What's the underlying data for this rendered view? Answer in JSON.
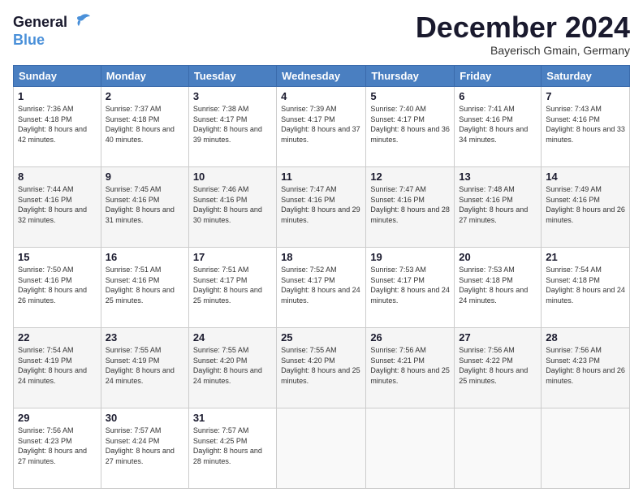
{
  "header": {
    "logo_line1": "General",
    "logo_line2": "Blue",
    "month": "December 2024",
    "location": "Bayerisch Gmain, Germany"
  },
  "days_of_week": [
    "Sunday",
    "Monday",
    "Tuesday",
    "Wednesday",
    "Thursday",
    "Friday",
    "Saturday"
  ],
  "weeks": [
    [
      {
        "day": "1",
        "sunrise": "7:36 AM",
        "sunset": "4:18 PM",
        "daylight": "8 hours and 42 minutes."
      },
      {
        "day": "2",
        "sunrise": "7:37 AM",
        "sunset": "4:18 PM",
        "daylight": "8 hours and 40 minutes."
      },
      {
        "day": "3",
        "sunrise": "7:38 AM",
        "sunset": "4:17 PM",
        "daylight": "8 hours and 39 minutes."
      },
      {
        "day": "4",
        "sunrise": "7:39 AM",
        "sunset": "4:17 PM",
        "daylight": "8 hours and 37 minutes."
      },
      {
        "day": "5",
        "sunrise": "7:40 AM",
        "sunset": "4:17 PM",
        "daylight": "8 hours and 36 minutes."
      },
      {
        "day": "6",
        "sunrise": "7:41 AM",
        "sunset": "4:16 PM",
        "daylight": "8 hours and 34 minutes."
      },
      {
        "day": "7",
        "sunrise": "7:43 AM",
        "sunset": "4:16 PM",
        "daylight": "8 hours and 33 minutes."
      }
    ],
    [
      {
        "day": "8",
        "sunrise": "7:44 AM",
        "sunset": "4:16 PM",
        "daylight": "8 hours and 32 minutes."
      },
      {
        "day": "9",
        "sunrise": "7:45 AM",
        "sunset": "4:16 PM",
        "daylight": "8 hours and 31 minutes."
      },
      {
        "day": "10",
        "sunrise": "7:46 AM",
        "sunset": "4:16 PM",
        "daylight": "8 hours and 30 minutes."
      },
      {
        "day": "11",
        "sunrise": "7:47 AM",
        "sunset": "4:16 PM",
        "daylight": "8 hours and 29 minutes."
      },
      {
        "day": "12",
        "sunrise": "7:47 AM",
        "sunset": "4:16 PM",
        "daylight": "8 hours and 28 minutes."
      },
      {
        "day": "13",
        "sunrise": "7:48 AM",
        "sunset": "4:16 PM",
        "daylight": "8 hours and 27 minutes."
      },
      {
        "day": "14",
        "sunrise": "7:49 AM",
        "sunset": "4:16 PM",
        "daylight": "8 hours and 26 minutes."
      }
    ],
    [
      {
        "day": "15",
        "sunrise": "7:50 AM",
        "sunset": "4:16 PM",
        "daylight": "8 hours and 26 minutes."
      },
      {
        "day": "16",
        "sunrise": "7:51 AM",
        "sunset": "4:16 PM",
        "daylight": "8 hours and 25 minutes."
      },
      {
        "day": "17",
        "sunrise": "7:51 AM",
        "sunset": "4:17 PM",
        "daylight": "8 hours and 25 minutes."
      },
      {
        "day": "18",
        "sunrise": "7:52 AM",
        "sunset": "4:17 PM",
        "daylight": "8 hours and 24 minutes."
      },
      {
        "day": "19",
        "sunrise": "7:53 AM",
        "sunset": "4:17 PM",
        "daylight": "8 hours and 24 minutes."
      },
      {
        "day": "20",
        "sunrise": "7:53 AM",
        "sunset": "4:18 PM",
        "daylight": "8 hours and 24 minutes."
      },
      {
        "day": "21",
        "sunrise": "7:54 AM",
        "sunset": "4:18 PM",
        "daylight": "8 hours and 24 minutes."
      }
    ],
    [
      {
        "day": "22",
        "sunrise": "7:54 AM",
        "sunset": "4:19 PM",
        "daylight": "8 hours and 24 minutes."
      },
      {
        "day": "23",
        "sunrise": "7:55 AM",
        "sunset": "4:19 PM",
        "daylight": "8 hours and 24 minutes."
      },
      {
        "day": "24",
        "sunrise": "7:55 AM",
        "sunset": "4:20 PM",
        "daylight": "8 hours and 24 minutes."
      },
      {
        "day": "25",
        "sunrise": "7:55 AM",
        "sunset": "4:20 PM",
        "daylight": "8 hours and 25 minutes."
      },
      {
        "day": "26",
        "sunrise": "7:56 AM",
        "sunset": "4:21 PM",
        "daylight": "8 hours and 25 minutes."
      },
      {
        "day": "27",
        "sunrise": "7:56 AM",
        "sunset": "4:22 PM",
        "daylight": "8 hours and 25 minutes."
      },
      {
        "day": "28",
        "sunrise": "7:56 AM",
        "sunset": "4:23 PM",
        "daylight": "8 hours and 26 minutes."
      }
    ],
    [
      {
        "day": "29",
        "sunrise": "7:56 AM",
        "sunset": "4:23 PM",
        "daylight": "8 hours and 27 minutes."
      },
      {
        "day": "30",
        "sunrise": "7:57 AM",
        "sunset": "4:24 PM",
        "daylight": "8 hours and 27 minutes."
      },
      {
        "day": "31",
        "sunrise": "7:57 AM",
        "sunset": "4:25 PM",
        "daylight": "8 hours and 28 minutes."
      },
      null,
      null,
      null,
      null
    ]
  ]
}
